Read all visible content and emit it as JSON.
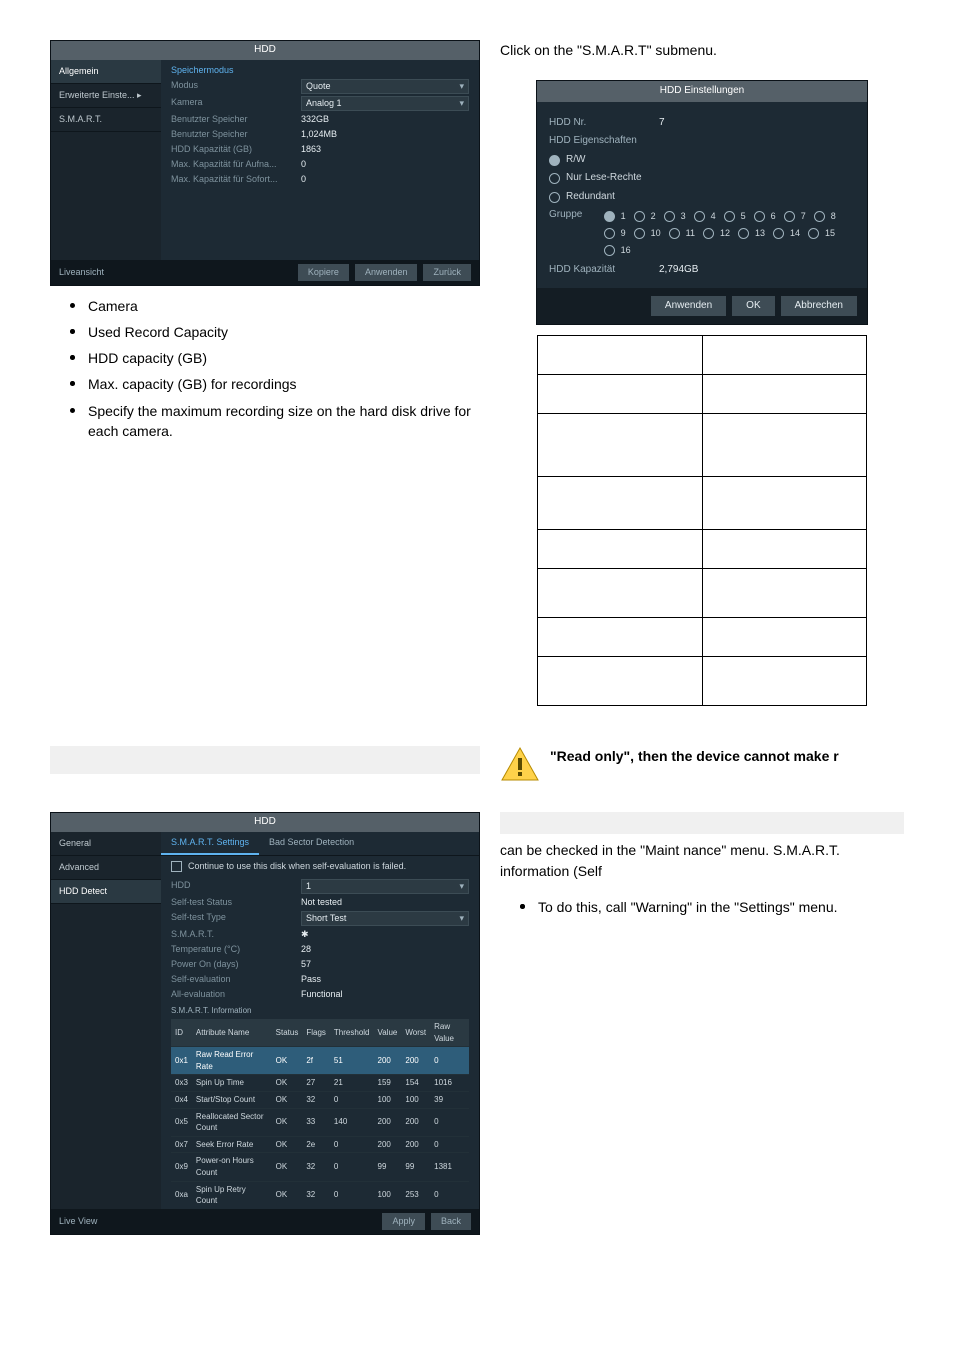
{
  "intro_right": "Click on the \"S.M.A.R.T\" submenu.",
  "win1": {
    "title": "HDD",
    "sidebar": [
      "Allgemein",
      "Erweiterte Einste...  ▸",
      "S.M.A.R.T."
    ],
    "sidebar_active": 0,
    "header": "Speichermodus",
    "rows": [
      {
        "k": "Modus",
        "v": "Quote",
        "sel": true
      },
      {
        "k": "Kamera",
        "v": "Analog 1",
        "sel": true
      },
      {
        "k": "Benutzter Speicher",
        "v": "332GB"
      },
      {
        "k": "Benutzter Speicher",
        "v": "1,024MB"
      },
      {
        "k": "HDD Kapazität (GB)",
        "v": "1863"
      },
      {
        "k": "Max. Kapazität für Aufna...",
        "v": "0"
      },
      {
        "k": "Max. Kapazität für Sofort...",
        "v": "0"
      }
    ],
    "foot_left": "Liveansicht",
    "buttons": [
      "Kopiere",
      "Anwenden",
      "Zurück"
    ]
  },
  "bullets1": [
    "Camera",
    "",
    "Used Record Capacity",
    "",
    "HDD capacity (GB)",
    "",
    "Max. capacity (GB) for recordings",
    "Specify the maximum recording size on the hard disk drive for each camera."
  ],
  "hdd_dialog": {
    "title": "HDD Einstellungen",
    "rows": {
      "nr_label": "HDD Nr.",
      "nr_val": "7",
      "props_label": "HDD Eigenschaften",
      "opt_rw": "R/W",
      "opt_ro": "Nur Lese-Rechte",
      "opt_red": "Redundant",
      "grp_label": "Gruppe",
      "groups": [
        "1",
        "2",
        "3",
        "4",
        "5",
        "6",
        "7",
        "8",
        "9",
        "10",
        "11",
        "12",
        "13",
        "14",
        "15",
        "16"
      ],
      "cap_label": "HDD Kapazität",
      "cap_val": "2,794GB"
    },
    "buttons": [
      "Anwenden",
      "OK",
      "Abbrechen"
    ]
  },
  "win2": {
    "title": "HDD",
    "sidebar": [
      "General",
      "Advanced",
      "HDD Detect"
    ],
    "sidebar_active": 2,
    "tabs": [
      "S.M.A.R.T. Settings",
      "Bad Sector Detection"
    ],
    "tabs_active": 0,
    "checkbox_label": "Continue to use this disk when self-evaluation is failed.",
    "kv": [
      {
        "k": "HDD",
        "v": "1",
        "sel": true
      },
      {
        "k": "Self-test Status",
        "v": "Not tested"
      },
      {
        "k": "Self-test Type",
        "v": "Short Test",
        "sel": true
      },
      {
        "k": "S.M.A.R.T.",
        "v": "✱"
      },
      {
        "k": "Temperature (°C)",
        "v": "28"
      },
      {
        "k": "Power On (days)",
        "v": "57"
      },
      {
        "k": "Self-evaluation",
        "v": "Pass"
      },
      {
        "k": "All-evaluation",
        "v": "Functional"
      }
    ],
    "info_label": "S.M.A.R.T. Information",
    "thead": [
      "ID",
      "Attribute Name",
      "Status",
      "Flags",
      "Threshold",
      "Value",
      "Worst",
      "Raw Value"
    ],
    "rows": [
      [
        "0x1",
        "Raw Read Error Rate",
        "OK",
        "2f",
        "51",
        "200",
        "200",
        "0"
      ],
      [
        "0x3",
        "Spin Up Time",
        "OK",
        "27",
        "21",
        "159",
        "154",
        "1016"
      ],
      [
        "0x4",
        "Start/Stop Count",
        "OK",
        "32",
        "0",
        "100",
        "100",
        "39"
      ],
      [
        "0x5",
        "Reallocated Sector Count",
        "OK",
        "33",
        "140",
        "200",
        "200",
        "0"
      ],
      [
        "0x7",
        "Seek Error Rate",
        "OK",
        "2e",
        "0",
        "200",
        "200",
        "0"
      ],
      [
        "0x9",
        "Power-on Hours Count",
        "OK",
        "32",
        "0",
        "99",
        "99",
        "1381"
      ],
      [
        "0xa",
        "Spin Up Retry Count",
        "OK",
        "32",
        "0",
        "100",
        "253",
        "0"
      ]
    ],
    "foot_left": "Live View",
    "buttons": [
      "Apply",
      "Back"
    ]
  },
  "note_text": "\"Read only\", then the device cannot make r",
  "maint_text": "can be checked in the \"Maint nance\" menu. S.M.A.R.T. information (Self",
  "bullets2": [
    "",
    "",
    "To do this, call \"Warning\" in the \"Settings\" menu."
  ]
}
